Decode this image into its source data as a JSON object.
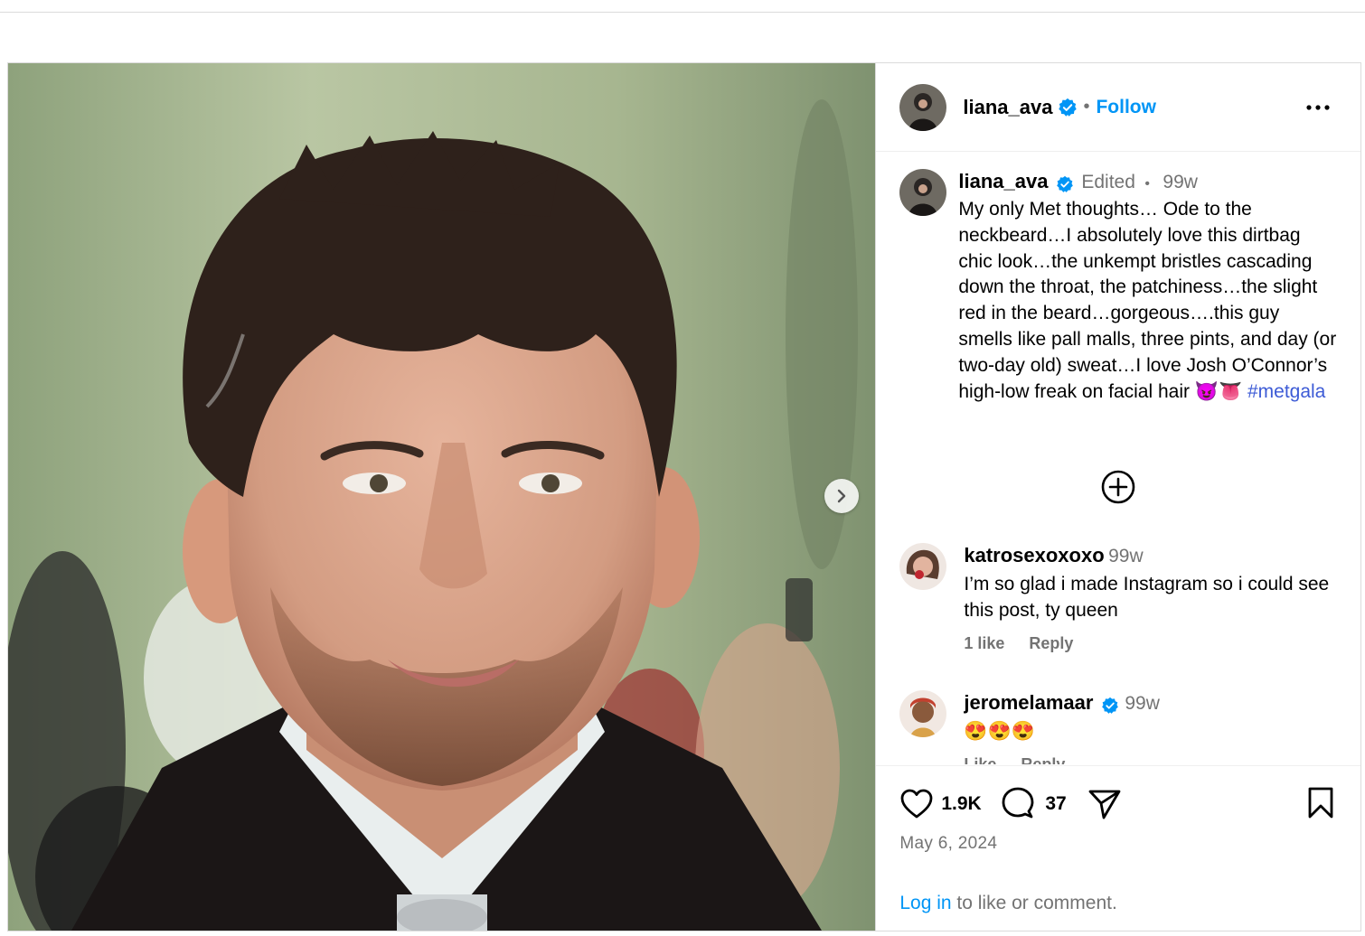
{
  "post": {
    "author": "liana_ava",
    "follow_label": "Follow",
    "dot": "•",
    "caption": {
      "username": "liana_ava",
      "edited": "Edited",
      "sep": "•",
      "age": "99w",
      "text": "My only Met thoughts… Ode to the neckbeard…I absolutely love this dirtbag chic look…the unkempt bristles cascading down the throat, the patchiness…the slight red in the beard…gorgeous….this guy smells like pall malls, three pints, and day (or two-day old) sweat…I love Josh O’Connor’s high-low freak on facial hair ",
      "emoji": "😈👅",
      "hashtag": "#metgala"
    },
    "comments": [
      {
        "username": "katrosexoxoxo",
        "age": "99w",
        "text": "I’m so glad i made Instagram so i could see this post, ty queen",
        "likes_label": "1 like",
        "reply_label": "Reply"
      },
      {
        "username": "jeromelamaar",
        "age": "99w",
        "text": "😍😍😍",
        "likes_label": "Like",
        "reply_label": "Reply"
      }
    ],
    "likes_count": "1.9K",
    "comments_count": "37",
    "date": "May 6, 2024",
    "login_link": "Log in",
    "login_rest": " to like or comment."
  },
  "icons": {
    "verified": "verified-badge-icon",
    "more": "more-options-icon",
    "next": "chevron-right-icon",
    "load_more": "plus-circle-icon",
    "like": "heart-icon",
    "comment": "comment-bubble-icon",
    "share": "paper-plane-icon",
    "save": "bookmark-icon"
  },
  "colors": {
    "accent": "#0095f6",
    "verified": "#0095f6",
    "hashtag": "#3d5bd6",
    "secondary_text": "#737373"
  }
}
